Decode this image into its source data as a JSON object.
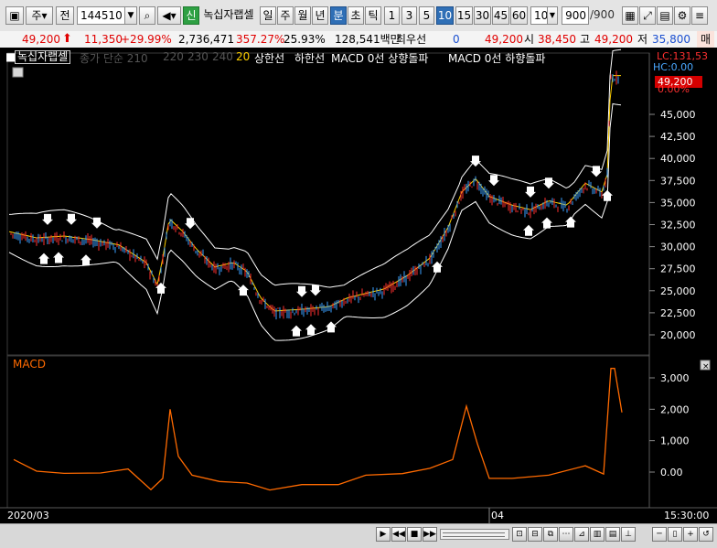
{
  "toolbar": {
    "market": "주",
    "period_mode": "전",
    "stock_code": "144510",
    "badge": "신",
    "stock_name": "녹십자랩셀",
    "period_tabs": [
      "일",
      "주",
      "월",
      "년",
      "분",
      "초",
      "틱"
    ],
    "interval_tabs": [
      "1",
      "3",
      "5",
      "10",
      "15",
      "30",
      "45",
      "60"
    ],
    "active_interval": "10",
    "count_value": "10",
    "data_count": "900",
    "data_count_total": "/900"
  },
  "infobar": {
    "price": "49,200",
    "change": "11,350",
    "change_pct": "+29.99%",
    "volume": "2,736,471",
    "volume_ratio": "357.27%",
    "turnover": "25.93%",
    "amount": "128,541백만",
    "tag": "최우선",
    "zero": "0",
    "price2": "49,200",
    "open_label": "시",
    "open": "38,450",
    "high_label": "고",
    "high": "49,200",
    "low_label": "저",
    "low": "35,800",
    "extra": "매"
  },
  "legend": {
    "name": "녹십자랩셀",
    "ma": "종가 단순 210",
    "ma2": "220",
    "ma3": "230",
    "ma4": "240",
    "ma5": "20",
    "upper": "상한선",
    "lower": "하한선",
    "macd_up": "MACD 0선 상향돌파",
    "macd_down": "MACD 0선 하향돌파"
  },
  "price_axis": {
    "lc": "LC:131,53",
    "hc": "HC:0.00",
    "current": "49,200",
    "current_pct": "0.00%",
    "ticks": [
      "45,000",
      "42,500",
      "40,000",
      "37,500",
      "35,000",
      "32,500",
      "30,000",
      "27,500",
      "25,000",
      "22,500",
      "20,000"
    ]
  },
  "macd": {
    "title": "MACD",
    "ticks": [
      "3,000",
      "2,000",
      "1,000",
      "0.00"
    ]
  },
  "time_axis": {
    "start": "2020/03",
    "mid": "04",
    "end": "15:30:00"
  },
  "colors": {
    "up": "#ff3030",
    "down": "#3aa0ff",
    "macd": "#ff6a00",
    "band": "#ffffff",
    "ma": "#ffd000"
  }
}
